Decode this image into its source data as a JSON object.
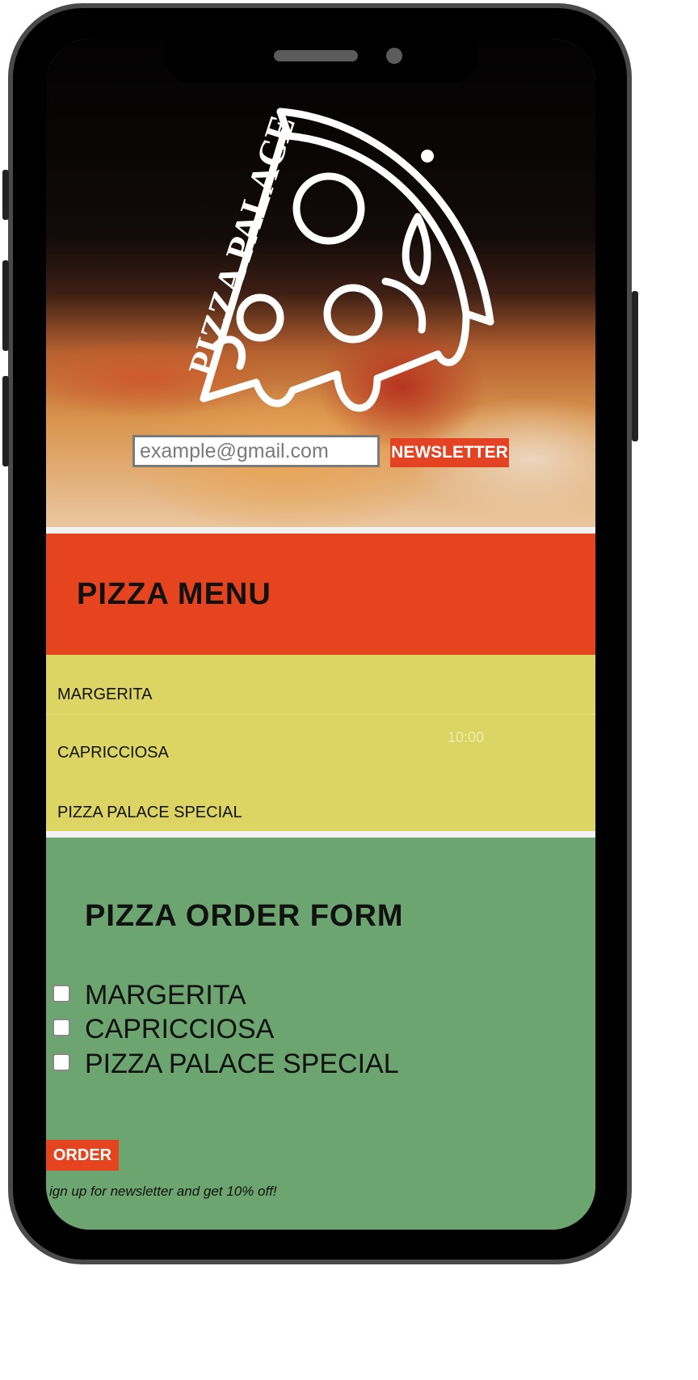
{
  "hero": {
    "logo_text": "PIZZA PALACE",
    "newsletter": {
      "email_value": "example@gmail.com",
      "button_label": "NEWSLETTER"
    }
  },
  "menu": {
    "title": "PIZZA MENU",
    "items": [
      "MARGERITA",
      "CAPRICCIOSA",
      "PIZZA PALACE SPECIAL"
    ],
    "overlay_time": "10:00"
  },
  "order_form": {
    "title": "PIZZA ORDER FORM",
    "options": [
      {
        "label": "MARGERITA",
        "checked": false
      },
      {
        "label": "CAPRICCIOSA",
        "checked": false
      },
      {
        "label": "PIZZA PALACE SPECIAL",
        "checked": false
      }
    ],
    "order_label": "ORDER",
    "footnote": "ign up for newsletter and get 10% off!"
  },
  "colors": {
    "accent_red": "#e5441e",
    "menu_yellow": "#ddd563",
    "form_green": "#6ca570"
  }
}
